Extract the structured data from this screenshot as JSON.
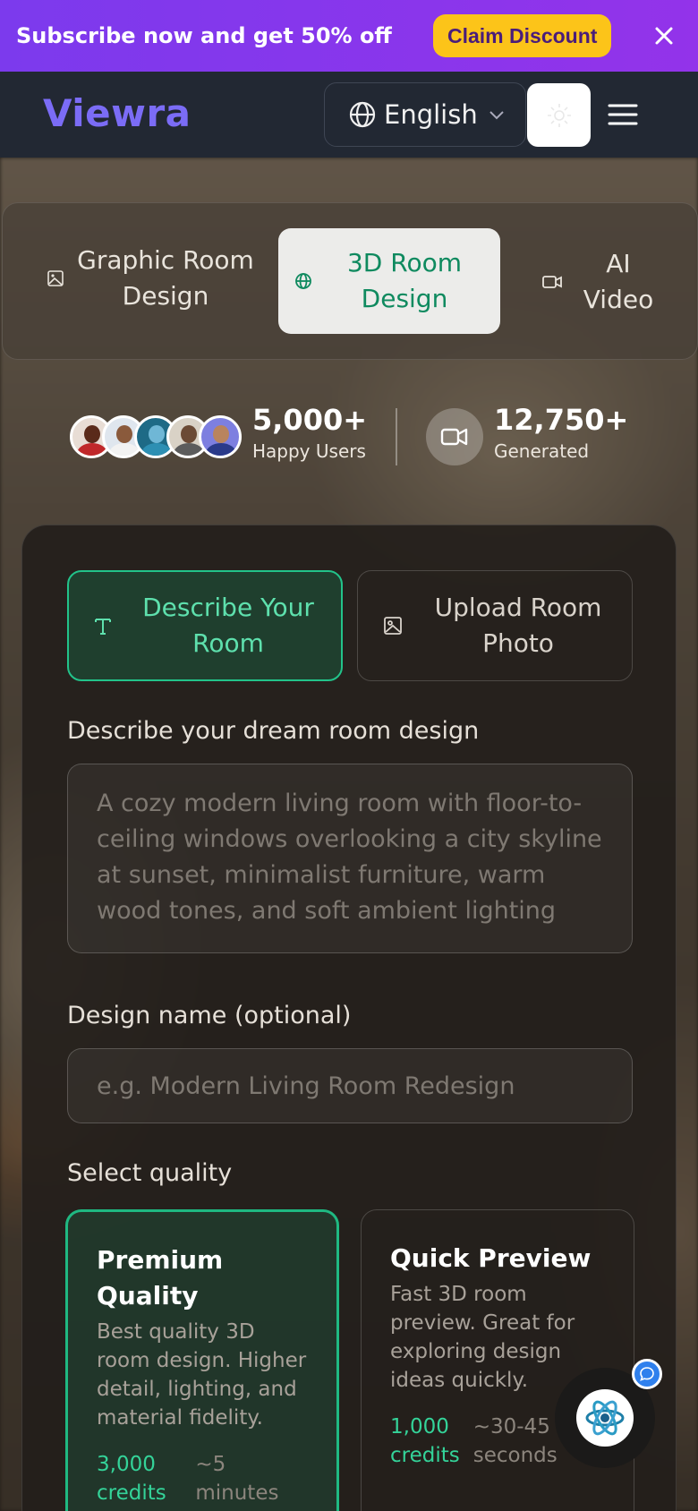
{
  "promo": {
    "text": "Subscribe now and get 50% off",
    "cta": "Claim Discount",
    "colors": {
      "bar": "#8b35ea",
      "cta_bg": "#fcc419"
    }
  },
  "header": {
    "logo": "Viewra",
    "language": "English",
    "icons": [
      "globe-icon",
      "chevron-down-icon",
      "sun-icon",
      "menu-icon"
    ]
  },
  "tabs": [
    {
      "label": "Graphic Room Design",
      "icon": "image-icon",
      "active": false
    },
    {
      "label": "3D Room Design",
      "icon": "globe-icon",
      "active": true
    },
    {
      "label": "AI Video",
      "icon": "video-icon",
      "active": false
    }
  ],
  "stats": {
    "users_value": "5,000+",
    "users_label": "Happy Users",
    "generated_value": "12,750+",
    "generated_label": "Generated"
  },
  "form": {
    "modes": [
      {
        "label": "Describe Your Room",
        "icon": "text-icon",
        "active": true
      },
      {
        "label": "Upload Room Photo",
        "icon": "image-icon",
        "active": false
      }
    ],
    "description_label": "Describe your dream room design",
    "description_placeholder": "A cozy modern living room with floor-to-ceiling windows overlooking a city skyline at sunset, minimalist furniture, warm wood tones, and soft ambient lighting",
    "name_label": "Design name (optional)",
    "name_placeholder": "e.g. Modern Living Room Redesign",
    "quality_label": "Select quality",
    "quality_options": [
      {
        "title": "Premium Quality",
        "desc": "Best quality 3D room design. Higher detail, lighting, and material fidelity.",
        "credits": "3,000 credits",
        "time": "~5 minutes",
        "selected": true
      },
      {
        "title": "Quick Preview",
        "desc": "Fast 3D room preview. Great for exploring design ideas quickly.",
        "credits": "1,000 credits",
        "time": "~30-45 seconds",
        "selected": false
      }
    ]
  },
  "accent": "#22c38a"
}
